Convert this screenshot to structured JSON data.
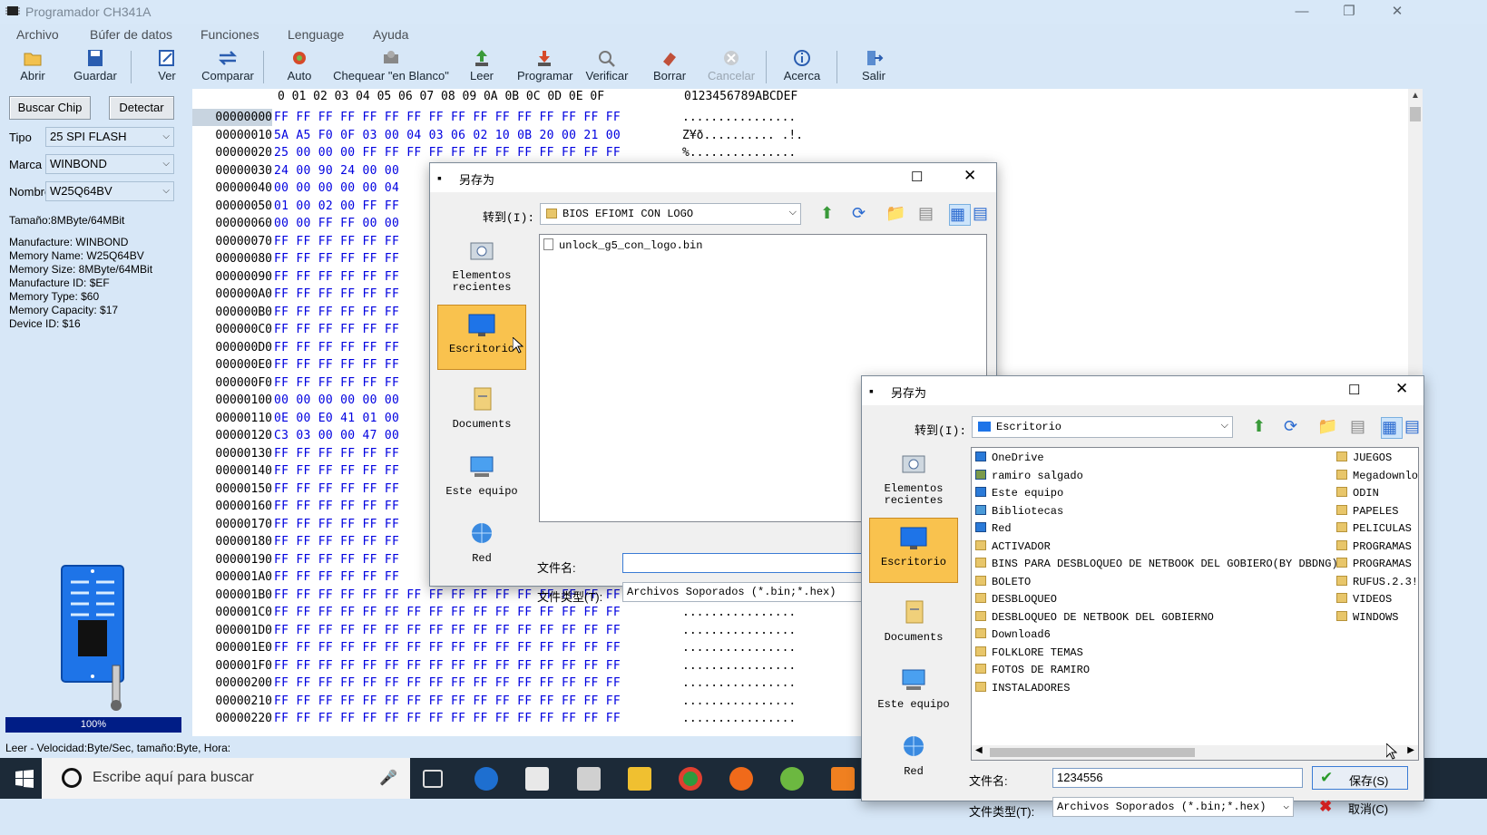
{
  "app": {
    "title": "Programador CH341A"
  },
  "menu": [
    "Archivo",
    "Búfer de datos",
    "Funciones",
    "Lenguage",
    "Ayuda"
  ],
  "toolbar": [
    "Abrir",
    "Guardar",
    "Ver",
    "Comparar",
    "Auto",
    "Chequear \"en Blanco\"",
    "Leer",
    "Programar",
    "Verificar",
    "Borrar",
    "Cancelar",
    "Acerca",
    "Salir"
  ],
  "left": {
    "buscar": "Buscar Chip",
    "detectar": "Detectar",
    "tipo_label": "Tipo",
    "tipo_value": "25 SPI FLASH",
    "marca_label": "Marca",
    "marca_value": "WINBOND",
    "nombre_label": "Nombre",
    "nombre_value": "W25Q64BV",
    "tamano": "Tamaño:8MByte/64MBit",
    "info": [
      "Manufacture: WINBOND",
      "Memory Name: W25Q64BV",
      "Memory Size: 8MByte/64MBit",
      "Manufacture ID: $EF",
      "Memory Type: $60",
      "Memory Capacity: $17",
      "Device ID: $16"
    ],
    "progress": "100%"
  },
  "hex": {
    "header_cols": "0 01 02 03 04 05 06 07 08 09 0A 0B 0C 0D 0E 0F",
    "header_ascii": "0123456789ABCDEF",
    "rows": [
      {
        "a": "00000000",
        "h": "FF FF FF FF FF FF FF FF FF FF FF FF FF FF FF FF",
        "t": "................"
      },
      {
        "a": "00000010",
        "h": "5A A5 F0 0F 03 00 04 03 06 02 10 0B 20 00 21 00",
        "t": "Z¥ð.......... .!."
      },
      {
        "a": "00000020",
        "h": "25 00 00 00 FF FF FF FF FF FF FF FF FF FF FF FF",
        "t": "%..............."
      },
      {
        "a": "00000030",
        "h": "24 00 90 24 00 00",
        "t": ""
      },
      {
        "a": "00000040",
        "h": "00 00 00 00 00 04",
        "t": ""
      },
      {
        "a": "00000050",
        "h": "01 00 02 00 FF FF",
        "t": ""
      },
      {
        "a": "00000060",
        "h": "00 00 FF FF 00 00",
        "t": ""
      },
      {
        "a": "00000070",
        "h": "FF FF FF FF FF FF",
        "t": ""
      },
      {
        "a": "00000080",
        "h": "FF FF FF FF FF FF",
        "t": ""
      },
      {
        "a": "00000090",
        "h": "FF FF FF FF FF FF",
        "t": ""
      },
      {
        "a": "000000A0",
        "h": "FF FF FF FF FF FF",
        "t": ""
      },
      {
        "a": "000000B0",
        "h": "FF FF FF FF FF FF",
        "t": ""
      },
      {
        "a": "000000C0",
        "h": "FF FF FF FF FF FF",
        "t": ""
      },
      {
        "a": "000000D0",
        "h": "FF FF FF FF FF FF",
        "t": ""
      },
      {
        "a": "000000E0",
        "h": "FF FF FF FF FF FF",
        "t": ""
      },
      {
        "a": "000000F0",
        "h": "FF FF FF FF FF FF",
        "t": ""
      },
      {
        "a": "00000100",
        "h": "00 00 00 00 00 00",
        "t": ""
      },
      {
        "a": "00000110",
        "h": "0E 00 E0 41 01 00",
        "t": ""
      },
      {
        "a": "00000120",
        "h": "C3 03 00 00 47 00",
        "t": ""
      },
      {
        "a": "00000130",
        "h": "FF FF FF FF FF FF",
        "t": ""
      },
      {
        "a": "00000140",
        "h": "FF FF FF FF FF FF",
        "t": ""
      },
      {
        "a": "00000150",
        "h": "FF FF FF FF FF FF",
        "t": ""
      },
      {
        "a": "00000160",
        "h": "FF FF FF FF FF FF",
        "t": ""
      },
      {
        "a": "00000170",
        "h": "FF FF FF FF FF FF",
        "t": ""
      },
      {
        "a": "00000180",
        "h": "FF FF FF FF FF FF",
        "t": ""
      },
      {
        "a": "00000190",
        "h": "FF FF FF FF FF FF",
        "t": ""
      },
      {
        "a": "000001A0",
        "h": "FF FF FF FF FF FF",
        "t": ""
      },
      {
        "a": "000001B0",
        "h": "FF FF FF FF FF FF FF FF FF FF FF FF FF FF FF FF",
        "t": "................"
      },
      {
        "a": "000001C0",
        "h": "FF FF FF FF FF FF FF FF FF FF FF FF FF FF FF FF",
        "t": "................"
      },
      {
        "a": "000001D0",
        "h": "FF FF FF FF FF FF FF FF FF FF FF FF FF FF FF FF",
        "t": "................"
      },
      {
        "a": "000001E0",
        "h": "FF FF FF FF FF FF FF FF FF FF FF FF FF FF FF FF",
        "t": "................"
      },
      {
        "a": "000001F0",
        "h": "FF FF FF FF FF FF FF FF FF FF FF FF FF FF FF FF",
        "t": "................"
      },
      {
        "a": "00000200",
        "h": "FF FF FF FF FF FF FF FF FF FF FF FF FF FF FF FF",
        "t": "................"
      },
      {
        "a": "00000210",
        "h": "FF FF FF FF FF FF FF FF FF FF FF FF FF FF FF FF",
        "t": "................"
      },
      {
        "a": "00000220",
        "h": "FF FF FF FF FF FF FF FF FF FF FF FF FF FF FF FF",
        "t": "................"
      }
    ]
  },
  "status": "Leer - Velocidad:Byte/Sec, tamaño:Byte, Hora:",
  "taskbar": {
    "search_placeholder": "Escribe aquí para buscar"
  },
  "dialog1": {
    "title": "另存为",
    "goto_label": "转到(I):",
    "goto_value": "BIOS EFIOMI CON LOGO",
    "places": [
      "Elementos recientes",
      "Escritorio",
      "Documents",
      "Este equipo",
      "Red"
    ],
    "files": [
      "unlock_g5_con_logo.bin"
    ],
    "filename_label": "文件名:",
    "filename_value": "",
    "filetype_label": "文件类型(T):",
    "filetype_value": "Archivos Soporados (*.bin;*.hex)"
  },
  "dialog2": {
    "title": "另存为",
    "goto_label": "转到(I):",
    "goto_value": "Escritorio",
    "places": [
      "Elementos recientes",
      "Escritorio",
      "Documents",
      "Este equipo",
      "Red"
    ],
    "files_col1": [
      "OneDrive",
      "ramiro salgado",
      "Este equipo",
      "Bibliotecas",
      "Red",
      "ACTIVADOR",
      "BINS PARA DESBLOQUEO DE NETBOOK DEL GOBIERO(BY DBDNG)",
      "BOLETO",
      "DESBLOQUEO",
      "DESBLOQUEO DE NETBOOK DEL GOBIERNO",
      "Download6",
      "FOLKLORE TEMAS",
      "FOTOS DE RAMIRO",
      "INSTALADORES"
    ],
    "files_col2": [
      "JUEGOS",
      "Megadownlo",
      "ODIN",
      "PAPELES",
      "PELICULAS",
      "PROGRAMAS",
      "PROGRAMAS F",
      "RUFUS.2.3!",
      "VIDEOS",
      "WINDOWS"
    ],
    "filename_label": "文件名:",
    "filename_value": "1234556",
    "filetype_label": "文件类型(T):",
    "filetype_value": "Archivos Soporados (*.bin;*.hex)",
    "save_label": "保存(S)",
    "cancel_label": "取消(C)"
  }
}
